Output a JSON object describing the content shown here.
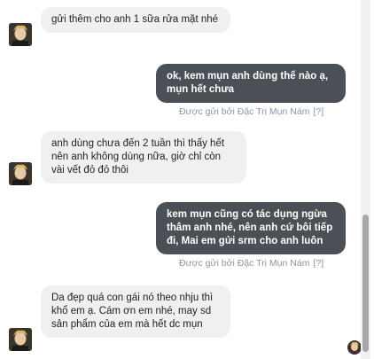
{
  "messages": [
    {
      "id": "m1",
      "from": "contact",
      "text": "gửi thêm cho anh 1 sữa rửa mặt nhé"
    },
    {
      "id": "m2",
      "from": "page",
      "text": "ok, kem mụn anh dùng thế nào ạ, mụn hết chưa"
    },
    {
      "id": "m3",
      "from": "contact",
      "text": "anh dùng chưa đến 2 tuần thì thấy hết nên anh không dùng nữa, giờ chỉ còn vài vết đỏ đỏ thôi"
    },
    {
      "id": "m4",
      "from": "page",
      "text": "kem mụn cũng có tác dụng ngừa thâm anh nhé, nên anh cứ bôi tiếp đi, Mai em gửi srm cho anh luôn"
    },
    {
      "id": "m5",
      "from": "contact",
      "text": "Da đẹp quá con gái nó theo nhju thì khổ em ạ. Cám ơn em nhé, may sd sản phẩm của em mà hết dc mụn"
    }
  ],
  "sent_by_label": "Được gửi bởi Đặc Trị Mụn Nám",
  "help_label": "[?]",
  "icons": {
    "avatar": "contact-avatar",
    "seen": "seen-avatar"
  },
  "colors": {
    "incoming_bubble": "#f1f0f0",
    "outgoing_bubble": "#4b4f56",
    "meta_text": "#90949c"
  }
}
